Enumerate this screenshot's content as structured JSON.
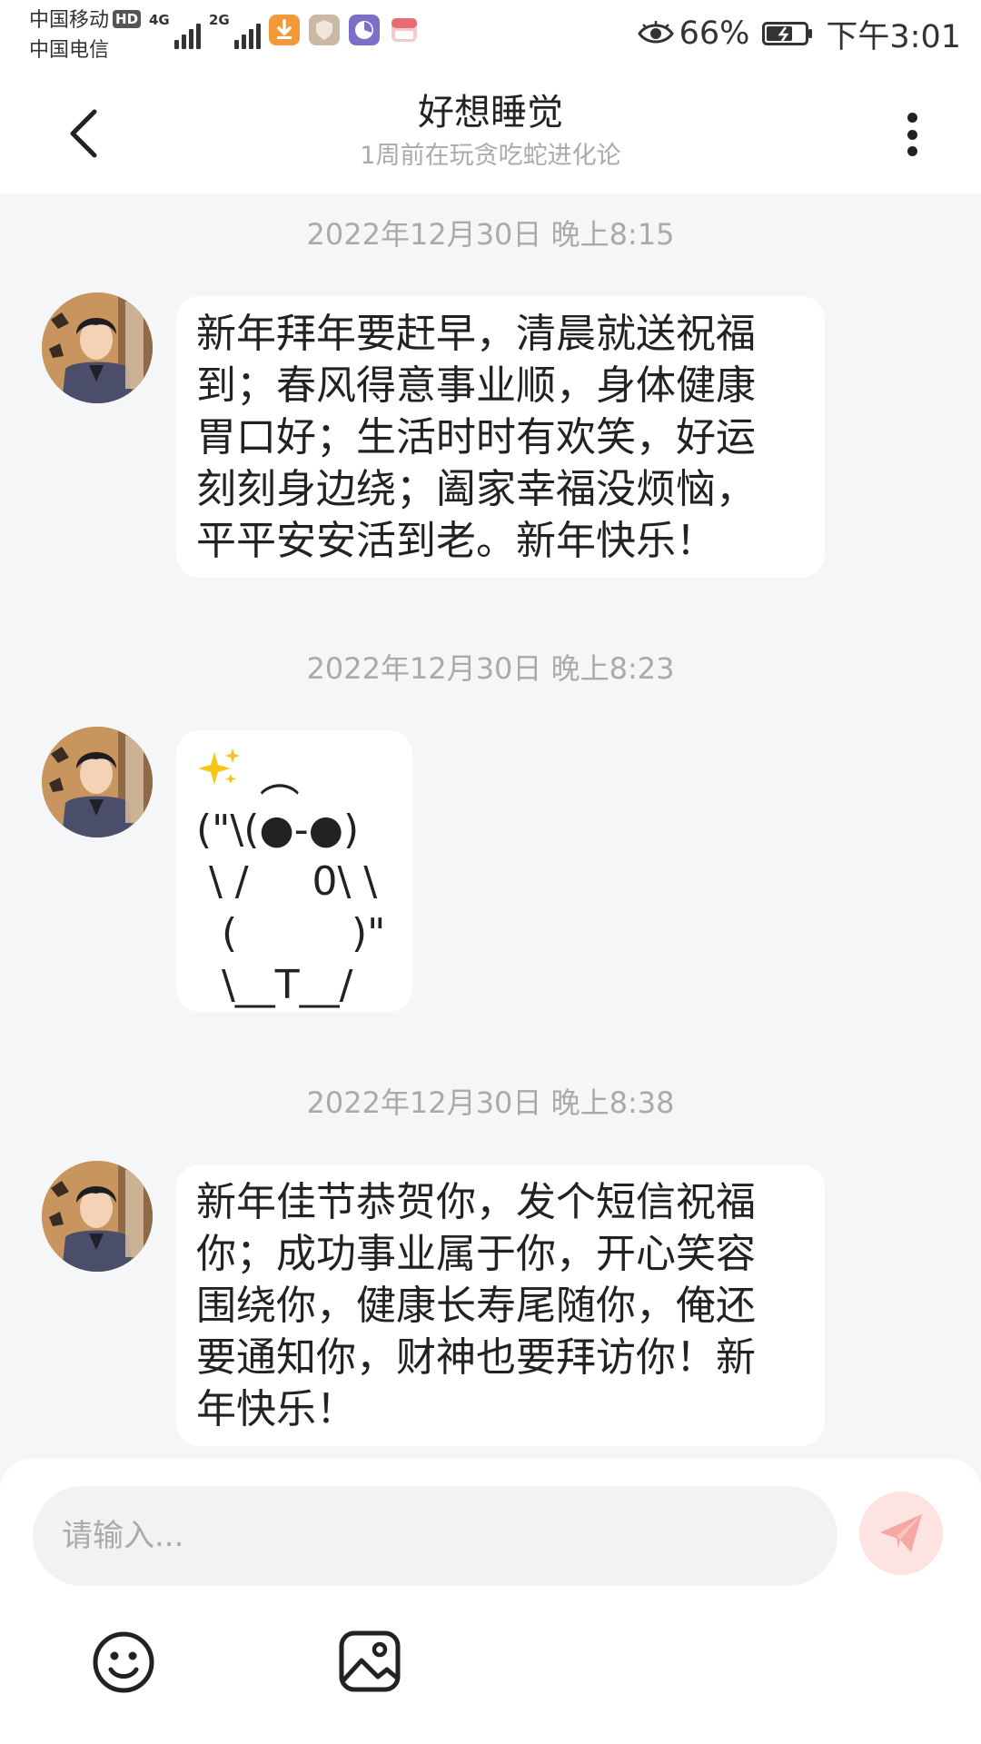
{
  "status_bar": {
    "carrier_1": "中国移动",
    "carrier_2": "中国电信",
    "hd_badge": "HD",
    "network_1": "4G",
    "network_2": "2G",
    "battery_percent": "66%",
    "time": "下午3:01",
    "icons": [
      "eye-icon",
      "download-icon",
      "shield-app-icon",
      "compass-app-icon",
      "box-app-icon",
      "battery-icon"
    ]
  },
  "header": {
    "title": "好想睡觉",
    "subtitle": "1周前在玩贪吃蛇进化论"
  },
  "messages": [
    {
      "timestamp": "2022年12月30日 晚上8:15",
      "text": "新年拜年要赶早，清晨就送祝福\n到；春风得意事业顺，身体健康\n胃口好；生活时时有欢笑，好运\n刻刻身边绕；阖家幸福没烦恼，\n平平安安活到老。新年快乐！"
    },
    {
      "timestamp": "2022年12月30日 晚上8:23",
      "art_sparkle": "✨",
      "text": "     ︵\n(\"\\(●-●)\n \\ /     0\\ \\\n  (         )\"\n  \\__T__/"
    },
    {
      "timestamp": "2022年12月30日 晚上8:38",
      "text": "新年佳节恭贺你，发个短信祝福\n你；成功事业属于你，开心笑容\n围绕你，健康长寿尾随你，俺还\n要通知你，财神也要拜访你！新\n年快乐！"
    }
  ],
  "composer": {
    "placeholder": "请输入...",
    "value": ""
  },
  "colors": {
    "page_background": "#f5f6f8",
    "bubble_background": "#ffffff",
    "send_button": "#fde3e2",
    "send_icon": "#f6a8a3",
    "timestamp_text": "#aaaaaa"
  }
}
